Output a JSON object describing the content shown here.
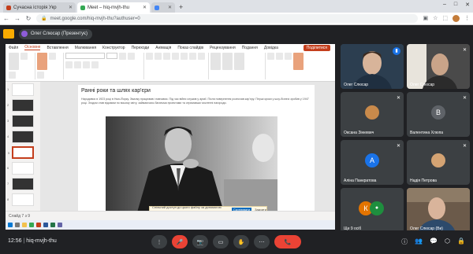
{
  "browser": {
    "tabs": [
      {
        "label": "Сучасна історія Укр",
        "favicon_color": "#c43e1c",
        "active": false
      },
      {
        "label": "Meet – hiq-mvjh-thu",
        "favicon_color": "#34a853",
        "active": true
      },
      {
        "label": "",
        "favicon_color": "#4285f4",
        "active": false
      }
    ],
    "url": "meet.google.com/hiq-mvjh-thu?authuser=0",
    "window_controls": [
      "–",
      "□",
      "✕"
    ]
  },
  "meet_header": {
    "presenter_label": "Олег Слюсар (Презентує)"
  },
  "powerpoint": {
    "ribbon_tabs": [
      "Файл",
      "Основне",
      "Вставлення",
      "Малювання",
      "Конструктор",
      "Переходи",
      "Анімація",
      "Показ слайдів",
      "Рецензування",
      "Подання",
      "Довідка"
    ],
    "share_label": "Поділитися",
    "slide_numbers": [
      "1",
      "2",
      "3",
      "4",
      "5",
      "6",
      "7",
      "8"
    ],
    "slide": {
      "title": "Ранні роки та шлях кар'єри",
      "body": "Народився в 1923 році в Нью-Йорку. Змалку працював і навчався. Під час війни служив у армії. Після повернення розпочав кар'єру. Перші кроки у шоу-бізнесі зробив у 1947 році. Згодом став відомим по всьому світу, займаючись багатьма проектами та отримавши численні нагороди."
    },
    "notice": {
      "text": "Спільний доступ до цього файлу за допомогою посилання",
      "button": "Скопіювати",
      "close": "Закрити"
    },
    "status": "Слайд 7 з 9"
  },
  "participants": [
    {
      "name": "Олег Слюсар",
      "type": "video",
      "bg": "#2c3e50",
      "mute": "✦"
    },
    {
      "name": "Олег Слюсар",
      "type": "video",
      "bg": "#4a4a4a",
      "mute": "✕"
    },
    {
      "name": "Оксана Зінкевич",
      "type": "photo",
      "color": "#c98a4b",
      "letter": ""
    },
    {
      "name": "Валентина Хлюпа",
      "type": "letter",
      "color": "#5f6368",
      "letter": "В"
    },
    {
      "name": "Аліна Панкратова",
      "type": "letter",
      "color": "#1a73e8",
      "letter": "А"
    },
    {
      "name": "Надія Петрова",
      "type": "photo",
      "color": "#d4a373",
      "letter": ""
    },
    {
      "name": "Ще 9 осіб",
      "type": "letters",
      "color": "#e37400",
      "letter": "К"
    },
    {
      "name": "Олег Слюсар (Ви)",
      "type": "video",
      "bg": "#6b5a4a",
      "mute": ""
    }
  ],
  "bottombar": {
    "time": "12:56",
    "meeting_code": "hiq-mvjh-thu",
    "controls": [
      "⋮",
      "🎤",
      "📷",
      "▭",
      "✋",
      "⋯",
      "📞"
    ],
    "right_icons": [
      "ⓘ",
      "👥",
      "💬",
      "⬡",
      "🔒"
    ]
  }
}
